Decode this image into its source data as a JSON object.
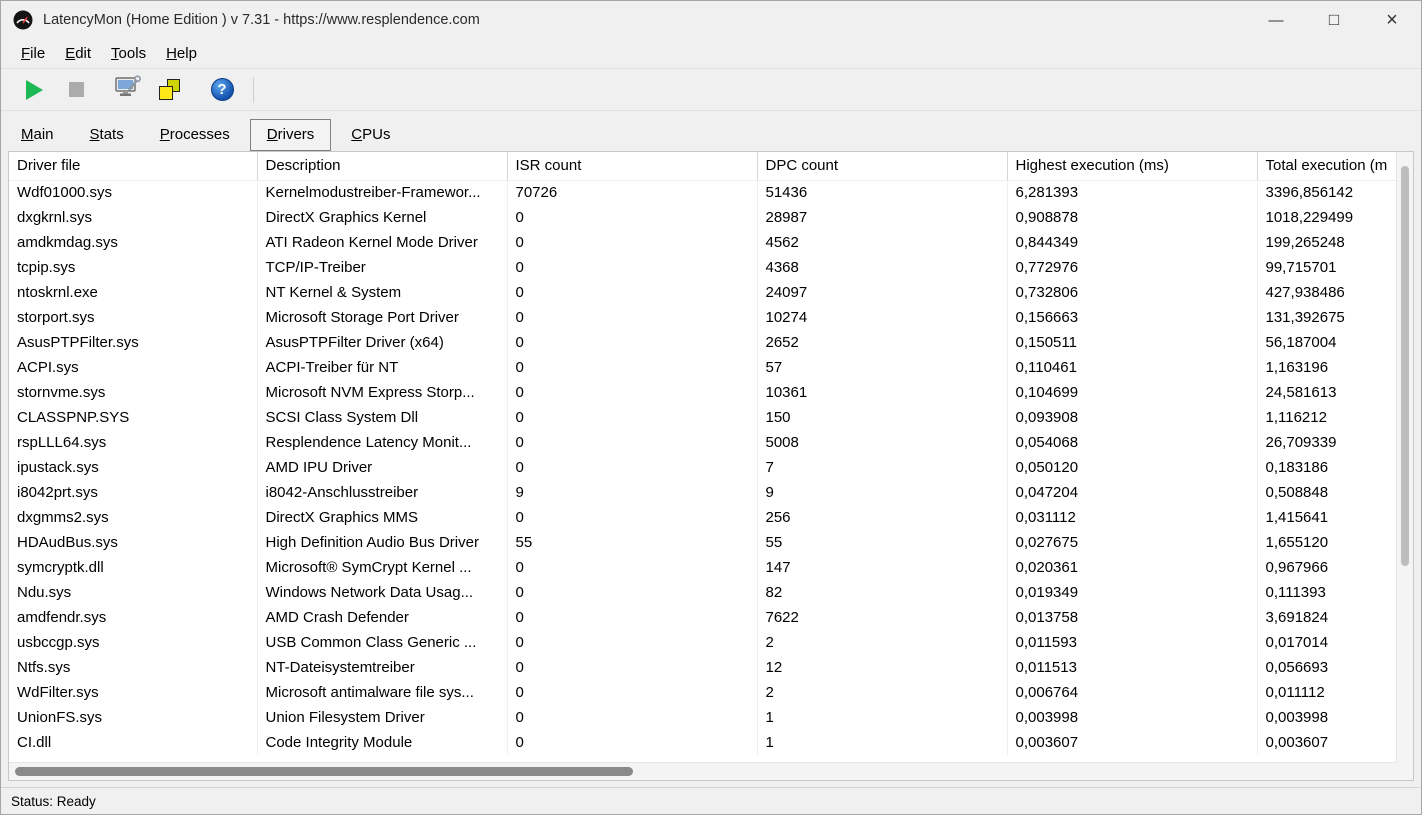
{
  "window": {
    "title": "LatencyMon  (Home Edition )  v 7.31 - https://www.resplendence.com",
    "controls": {
      "minimize": "—",
      "maximize": "□",
      "close": "×"
    }
  },
  "menu": {
    "items": [
      "File",
      "Edit",
      "Tools",
      "Help"
    ]
  },
  "toolbar": {
    "help_glyph": "?"
  },
  "tabs": [
    {
      "label": "Main",
      "active": false
    },
    {
      "label": "Stats",
      "active": false
    },
    {
      "label": "Processes",
      "active": false
    },
    {
      "label": "Drivers",
      "active": true
    },
    {
      "label": "CPUs",
      "active": false
    }
  ],
  "table": {
    "columns": [
      "Driver file",
      "Description",
      "ISR count",
      "DPC count",
      "Highest execution (ms)",
      "Total execution (m"
    ],
    "rows": [
      [
        "Wdf01000.sys",
        "Kernelmodustreiber-Framewor...",
        "70726",
        "51436",
        "6,281393",
        "3396,856142"
      ],
      [
        "dxgkrnl.sys",
        "DirectX Graphics Kernel",
        "0",
        "28987",
        "0,908878",
        "1018,229499"
      ],
      [
        "amdkmdag.sys",
        "ATI Radeon Kernel Mode Driver",
        "0",
        "4562",
        "0,844349",
        "199,265248"
      ],
      [
        "tcpip.sys",
        "TCP/IP-Treiber",
        "0",
        "4368",
        "0,772976",
        "99,715701"
      ],
      [
        "ntoskrnl.exe",
        "NT Kernel & System",
        "0",
        "24097",
        "0,732806",
        "427,938486"
      ],
      [
        "storport.sys",
        "Microsoft Storage Port Driver",
        "0",
        "10274",
        "0,156663",
        "131,392675"
      ],
      [
        "AsusPTPFilter.sys",
        "AsusPTPFilter Driver (x64)",
        "0",
        "2652",
        "0,150511",
        "56,187004"
      ],
      [
        "ACPI.sys",
        "ACPI-Treiber für NT",
        "0",
        "57",
        "0,110461",
        "1,163196"
      ],
      [
        "stornvme.sys",
        "Microsoft NVM Express Storp...",
        "0",
        "10361",
        "0,104699",
        "24,581613"
      ],
      [
        "CLASSPNP.SYS",
        "SCSI Class System Dll",
        "0",
        "150",
        "0,093908",
        "1,116212"
      ],
      [
        "rspLLL64.sys",
        "Resplendence Latency Monit...",
        "0",
        "5008",
        "0,054068",
        "26,709339"
      ],
      [
        "ipustack.sys",
        "AMD IPU Driver",
        "0",
        "7",
        "0,050120",
        "0,183186"
      ],
      [
        "i8042prt.sys",
        "i8042-Anschlusstreiber",
        "9",
        "9",
        "0,047204",
        "0,508848"
      ],
      [
        "dxgmms2.sys",
        "DirectX Graphics MMS",
        "0",
        "256",
        "0,031112",
        "1,415641"
      ],
      [
        "HDAudBus.sys",
        "High Definition Audio Bus Driver",
        "55",
        "55",
        "0,027675",
        "1,655120"
      ],
      [
        "symcryptk.dll",
        "Microsoft® SymCrypt Kernel ...",
        "0",
        "147",
        "0,020361",
        "0,967966"
      ],
      [
        "Ndu.sys",
        "Windows Network Data Usag...",
        "0",
        "82",
        "0,019349",
        "0,111393"
      ],
      [
        "amdfendr.sys",
        "AMD Crash Defender",
        "0",
        "7622",
        "0,013758",
        "3,691824"
      ],
      [
        "usbccgp.sys",
        "USB Common Class Generic ...",
        "0",
        "2",
        "0,011593",
        "0,017014"
      ],
      [
        "Ntfs.sys",
        "NT-Dateisystemtreiber",
        "0",
        "12",
        "0,011513",
        "0,056693"
      ],
      [
        "WdFilter.sys",
        "Microsoft antimalware file sys...",
        "0",
        "2",
        "0,006764",
        "0,011112"
      ],
      [
        "UnionFS.sys",
        "Union Filesystem Driver",
        "0",
        "1",
        "0,003998",
        "0,003998"
      ],
      [
        "CI.dll",
        "Code Integrity Module",
        "0",
        "1",
        "0,003607",
        "0,003607"
      ]
    ]
  },
  "status": {
    "text": "Status: Ready"
  }
}
